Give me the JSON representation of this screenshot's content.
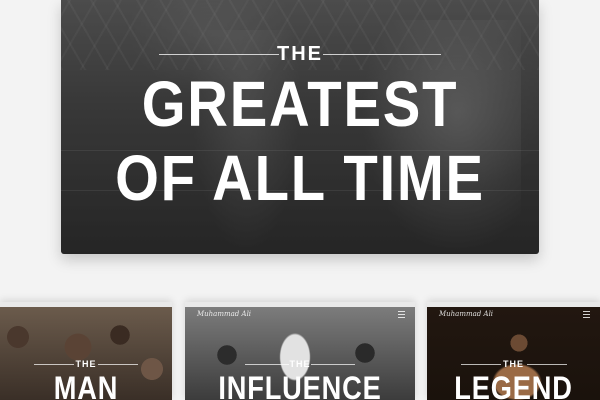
{
  "hero": {
    "kicker": "THE",
    "line1": "GREATEST",
    "line2": "OF ALL TIME"
  },
  "cards": [
    {
      "kicker": "THE",
      "title": "MAN"
    },
    {
      "kicker": "THE",
      "title": "INFLUENCE",
      "logo": "Muhammad Ali"
    },
    {
      "kicker": "THE",
      "title": "LEGEND",
      "logo": "Muhammad Ali"
    }
  ],
  "icons": {
    "menu": "hamburger-menu-icon"
  }
}
